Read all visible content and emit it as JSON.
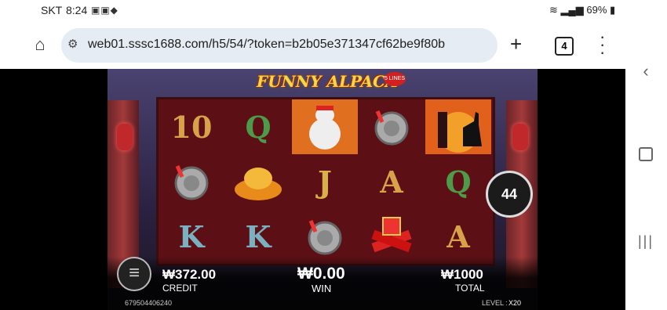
{
  "status": {
    "carrier": "SKT",
    "time": "8:24",
    "battery": "69%"
  },
  "browser": {
    "url": "web01.sssc1688.com/h5/54/?token=b2b05e371347cf62be9f80b",
    "tab_count": "4"
  },
  "game": {
    "title": "FUNNY ALPACA",
    "title_badge": "5 LINES",
    "bonus_counter": "44",
    "credit": {
      "value": "₩372.00",
      "label": "CREDIT"
    },
    "win": {
      "value": "₩0.00",
      "label": "WIN"
    },
    "total": {
      "value": "₩1000",
      "label": "TOTAL"
    },
    "game_id": "679504406240",
    "level_label": "LEVEL :",
    "level_value": "X20"
  },
  "reels": [
    [
      "10",
      "",
      "",
      ""
    ],
    [
      "Q",
      "",
      "",
      ""
    ],
    [
      "",
      "J",
      "",
      ""
    ],
    [
      "",
      "A",
      "",
      ""
    ],
    [
      "",
      "Q",
      "A",
      ""
    ]
  ],
  "colors": {
    "reel_bg": "#5c1015",
    "gold": "#d8b14a",
    "teal": "#7ab0c0"
  }
}
